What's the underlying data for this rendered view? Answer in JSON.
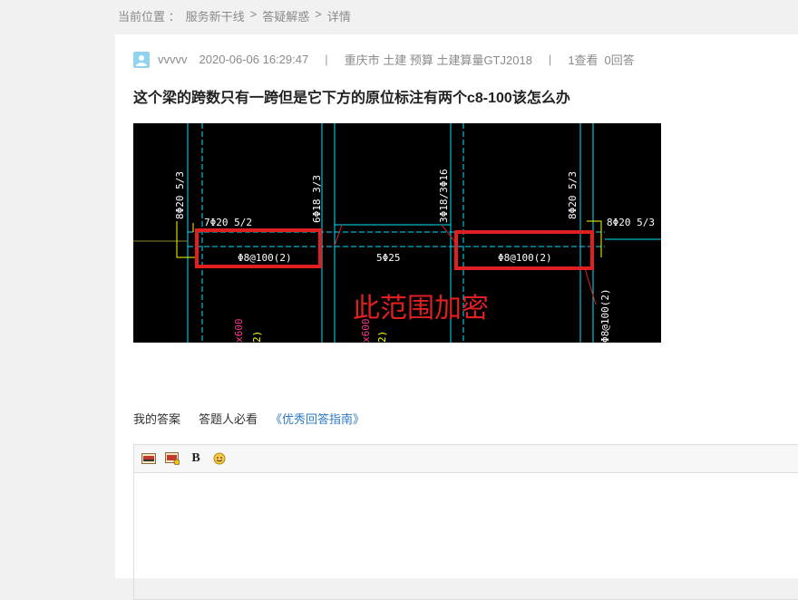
{
  "breadcrumb": {
    "label": "当前位置 ：",
    "items": [
      "服务新干线",
      "答疑解惑",
      "详情"
    ],
    "sep": ">"
  },
  "post": {
    "user": "vvvvv",
    "datetime": "2020-06-06 16:29:47",
    "tags": "重庆市  土建 预算 土建算量GTJ2018",
    "views": "1查看",
    "answers": "0回答",
    "title": "这个梁的跨数只有一跨但是它下方的原位标注有两个c8-100该怎么办"
  },
  "image": {
    "labels": {
      "left_vertical": "8Φ20 5/3",
      "left_horizontal": "7Φ20 5/2",
      "mid_vertical": "6Φ18 3/3",
      "mid_vertical2": "3Φ18/3Φ16",
      "right_vertical": "8Φ20 5/3",
      "right_horizontal": "8Φ20 5/3",
      "stirrup_left": "Φ8@100(2)",
      "stirrup_right": "Φ8@100(2)",
      "bottom_bar": "5Φ25",
      "right_stirrup_vertical": "Φ8@100(2)",
      "bottom_left_1": "x600",
      "bottom_left_2": "2)",
      "bottom_mid_1": "x600",
      "bottom_mid_2": "2)",
      "annotation": "此范围加密"
    },
    "colors": {
      "background": "#000000",
      "cyan": "#00ffff",
      "red": "#e02020",
      "yellow": "#ffff00",
      "white": "#ffffff"
    }
  },
  "answer": {
    "my_answer": "我的答案",
    "must_read": "答题人必看",
    "guide_link": "《优秀回答指南》"
  },
  "editor": {
    "bold_label": "B",
    "icons": [
      "image-icon",
      "image-upload-icon",
      "bold-icon",
      "emoji-icon"
    ]
  }
}
